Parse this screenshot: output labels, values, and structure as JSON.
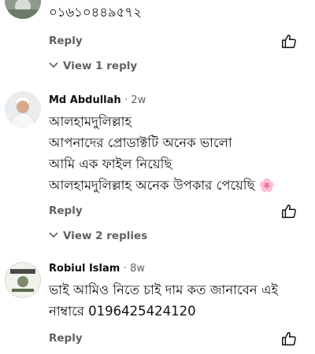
{
  "comments": [
    {
      "text_lines": [
        "০১৬১০৪৪৯৫৭২"
      ],
      "reply_label": "Reply",
      "view_replies": "View 1 reply"
    },
    {
      "author": "Md Abdullah",
      "age": "· 2w",
      "text_lines": [
        "আলহামদুলিল্লাহ",
        "আপনাদের প্রোডাক্টটি অনেক ভালো",
        "আমি এক ফাইল নিয়েছি",
        "আলহামদুলিল্লাহ অনেক উপকার পেয়েছি 🌸"
      ],
      "reply_label": "Reply",
      "view_replies": "View 2 replies"
    },
    {
      "author": "Robiul Islam",
      "age": "· 8w",
      "text_lines": [
        "ভাই আমিও নিতে চাই দাম কত জানাবেন এই",
        "নাম্বারে 0196425424120"
      ],
      "reply_label": "Reply"
    }
  ],
  "icons": {
    "like": "thumbs-up-icon",
    "chevron": "chevron-down-icon"
  },
  "colors": {
    "secondary_text": "#606060",
    "primary_text": "#0f0f0f"
  }
}
